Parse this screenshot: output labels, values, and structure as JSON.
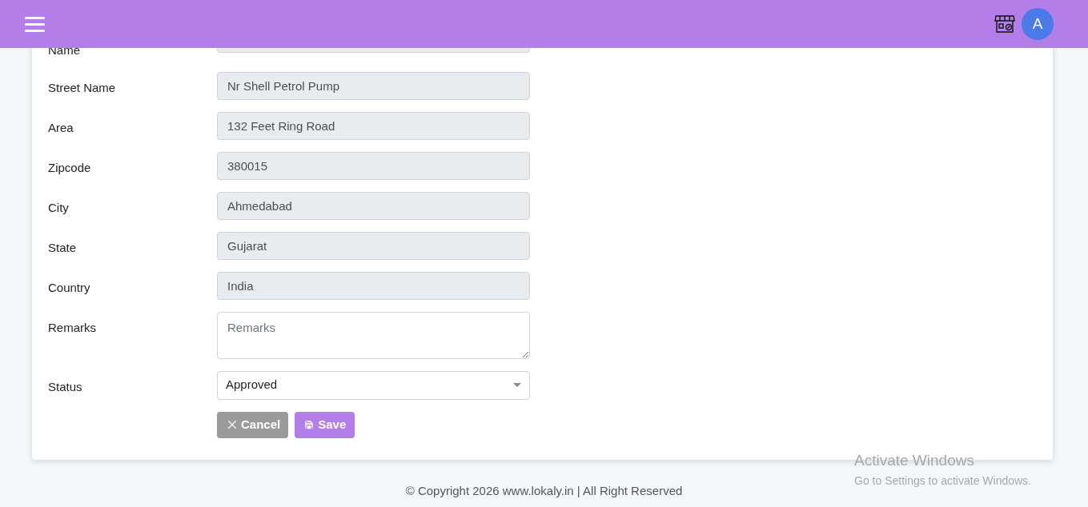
{
  "header": {
    "avatar_letter": "A"
  },
  "form": {
    "fields": [
      {
        "kind": "text_partly_hidden",
        "label": "Name"
      },
      {
        "kind": "text",
        "label": "Street Name",
        "value": "Nr Shell Petrol Pump"
      },
      {
        "kind": "text",
        "label": "Area",
        "value": "132 Feet Ring Road"
      },
      {
        "kind": "text",
        "label": "Zipcode",
        "value": "380015"
      },
      {
        "kind": "text",
        "label": "City",
        "value": "Ahmedabad"
      },
      {
        "kind": "text",
        "label": "State",
        "value": "Gujarat"
      },
      {
        "kind": "text",
        "label": "Country",
        "value": "India"
      },
      {
        "kind": "textarea",
        "label": "Remarks",
        "placeholder": "Remarks"
      },
      {
        "kind": "select",
        "label": "Status",
        "value": "Approved"
      }
    ],
    "buttons": [
      {
        "kind": "cancel",
        "label": "Cancel"
      },
      {
        "kind": "save",
        "label": "Save"
      }
    ]
  },
  "footer": "© Copyright 2026 www.lokaly.in | All Right Reserved",
  "os_notice": {
    "title": "Activate Windows",
    "subtitle": "Go to Settings to activate Windows."
  }
}
